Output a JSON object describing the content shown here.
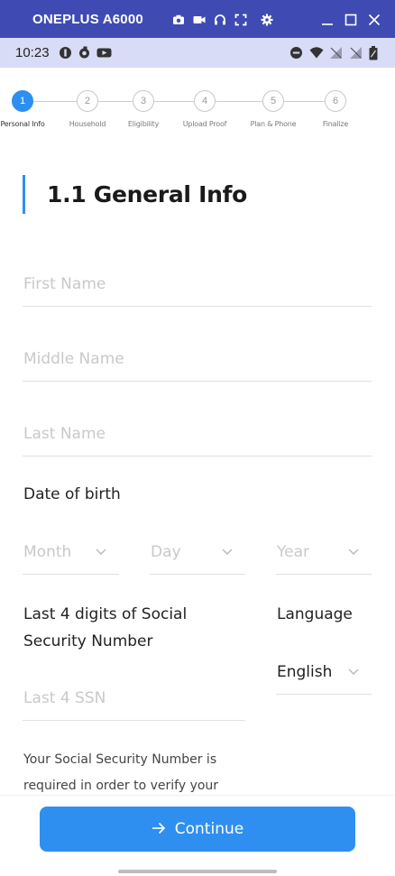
{
  "emulator": {
    "title": "ONEPLUS A6000",
    "icons": [
      "camera-icon",
      "video-icon",
      "headphones-icon",
      "fullscreen-icon",
      "gear-icon"
    ],
    "window_controls": [
      "minimize-icon",
      "maximize-icon",
      "close-icon"
    ]
  },
  "status_bar": {
    "time": "10:23",
    "left_icons": [
      "app-icon",
      "sync-icon",
      "youtube-icon"
    ],
    "right_icons": [
      "do-not-disturb-icon",
      "wifi-icon",
      "no-signal-icon",
      "no-signal-icon",
      "battery-icon"
    ]
  },
  "stepper": {
    "steps": [
      {
        "number": "1",
        "label": "Personal Info",
        "active": true
      },
      {
        "number": "2",
        "label": "Household",
        "active": false
      },
      {
        "number": "3",
        "label": "Eligibility",
        "active": false
      },
      {
        "number": "4",
        "label": "Upload Proof",
        "active": false
      },
      {
        "number": "5",
        "label": "Plan & Phone",
        "active": false
      },
      {
        "number": "6",
        "label": "Finalize",
        "active": false
      }
    ]
  },
  "section": {
    "title": "1.1 General Info"
  },
  "form": {
    "first_name_placeholder": "First Name",
    "middle_name_placeholder": "Middle Name",
    "last_name_placeholder": "Last Name",
    "dob_label": "Date of birth",
    "month_placeholder": "Month",
    "day_placeholder": "Day",
    "year_placeholder": "Year",
    "ssn_label_line1": "Last 4 digits of Social",
    "ssn_label_line2": "Security Number",
    "ssn_placeholder": "Last 4 SSN",
    "language_label": "Language",
    "language_value": "English",
    "ssn_note_line1": "Your Social Security Number is",
    "ssn_note_line2": "required in order to verify your"
  },
  "footer": {
    "continue_label": "Continue",
    "accent_color": "#2e8ff0"
  }
}
